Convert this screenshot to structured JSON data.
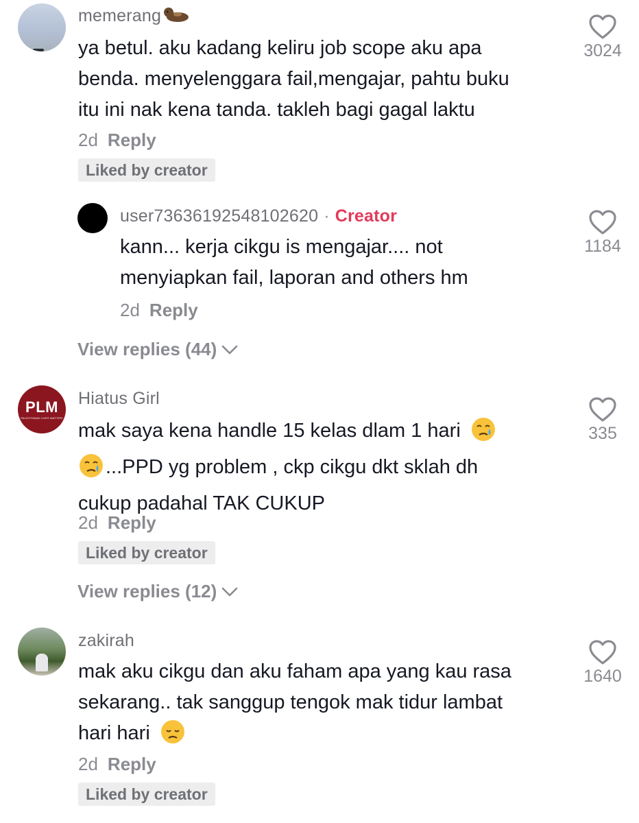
{
  "comments": [
    {
      "username": "memerang",
      "username_emoji": "otter",
      "text_lines": [
        "ya betul. aku kadang keliru job scope aku apa",
        "benda. menyelenggara fail,mengajar, pahtu buku",
        "itu ini nak kena tanda. takleh bagi gagal laktu"
      ],
      "time": "2d",
      "reply_label": "Reply",
      "liked_badge": "Liked by creator",
      "likes": "3024",
      "reply": {
        "username": "user73636192548102620",
        "separator": "·",
        "tag": "Creator",
        "text_lines": [
          "kann... kerja cikgu is mengajar.... not",
          "menyiapkan fail, laporan and others hm"
        ],
        "time": "2d",
        "reply_label": "Reply",
        "likes": "1184"
      },
      "view_replies": "View replies (44)"
    },
    {
      "username": "Hiatus Girl",
      "avatar_text": "PLM",
      "avatar_subtext": "PALESTINIAN LIVES MATTER!",
      "text_line1": "mak saya kena handle 15 kelas dlam 1 hari",
      "text_line2": "...PPD yg problem , ckp cikgu dkt sklah dh",
      "text_line3": "cukup padahal TAK CUKUP",
      "time": "2d",
      "reply_label": "Reply",
      "liked_badge": "Liked by creator",
      "likes": "335",
      "view_replies": "View replies (12)"
    },
    {
      "username": "zakirah",
      "text_line1": "mak aku cikgu dan aku faham apa yang kau rasa",
      "text_line2": "sekarang.. tak sanggup tengok mak tidur lambat",
      "text_line3": "hari hari",
      "time": "2d",
      "reply_label": "Reply",
      "liked_badge": "Liked by creator",
      "likes": "1640"
    }
  ],
  "colors": {
    "creator_tag": "#e23a5a",
    "plm_avatar": "#8b1620",
    "muted_text": "#8a8b91"
  },
  "icons": [
    "heart-outline-icon",
    "chevron-down-icon",
    "otter-emoji",
    "crying-face-emoji",
    "disappointed-face-emoji"
  ]
}
